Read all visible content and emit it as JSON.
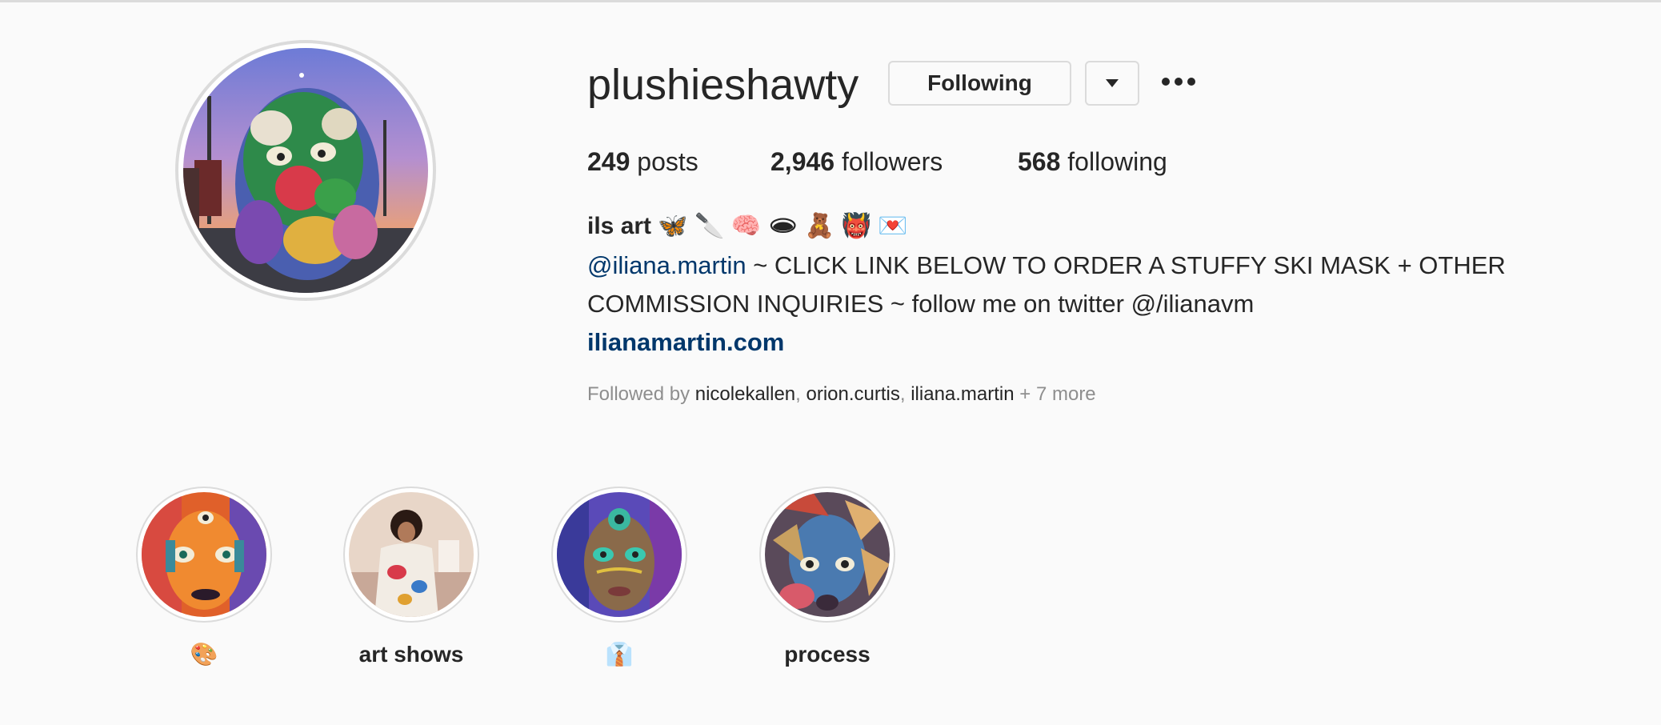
{
  "profile": {
    "username": "plushieshawty",
    "following_button": "Following",
    "stats": {
      "posts_count": "249",
      "posts_label": "posts",
      "followers_count": "2,946",
      "followers_label": "followers",
      "following_count": "568",
      "following_label": "following"
    },
    "bio": {
      "name": "ils art 🦋 🔪 🧠 🕳 🧸 👹 💌",
      "mention": "@iliana.martin",
      "text": " ~ CLICK LINK BELOW TO ORDER A STUFFY SKI MASK + OTHER COMMISSION INQUIRIES ~ follow me on twitter @/ilianavm",
      "link": "ilianamartin.com"
    },
    "followed_by": {
      "prefix": "Followed by ",
      "accounts": [
        "nicolekallen",
        "orion.curtis",
        "iliana.martin"
      ],
      "separator": ", ",
      "suffix": " + 7 more"
    }
  },
  "highlights": [
    {
      "label": "🎨"
    },
    {
      "label": "art shows"
    },
    {
      "label": "👔"
    },
    {
      "label": "process"
    }
  ],
  "icons": {
    "dropdown": "caret-down-icon",
    "more": "ellipsis-icon"
  },
  "colors": {
    "link": "#00376b",
    "muted": "#8e8e8e",
    "border": "#dbdbdb"
  }
}
